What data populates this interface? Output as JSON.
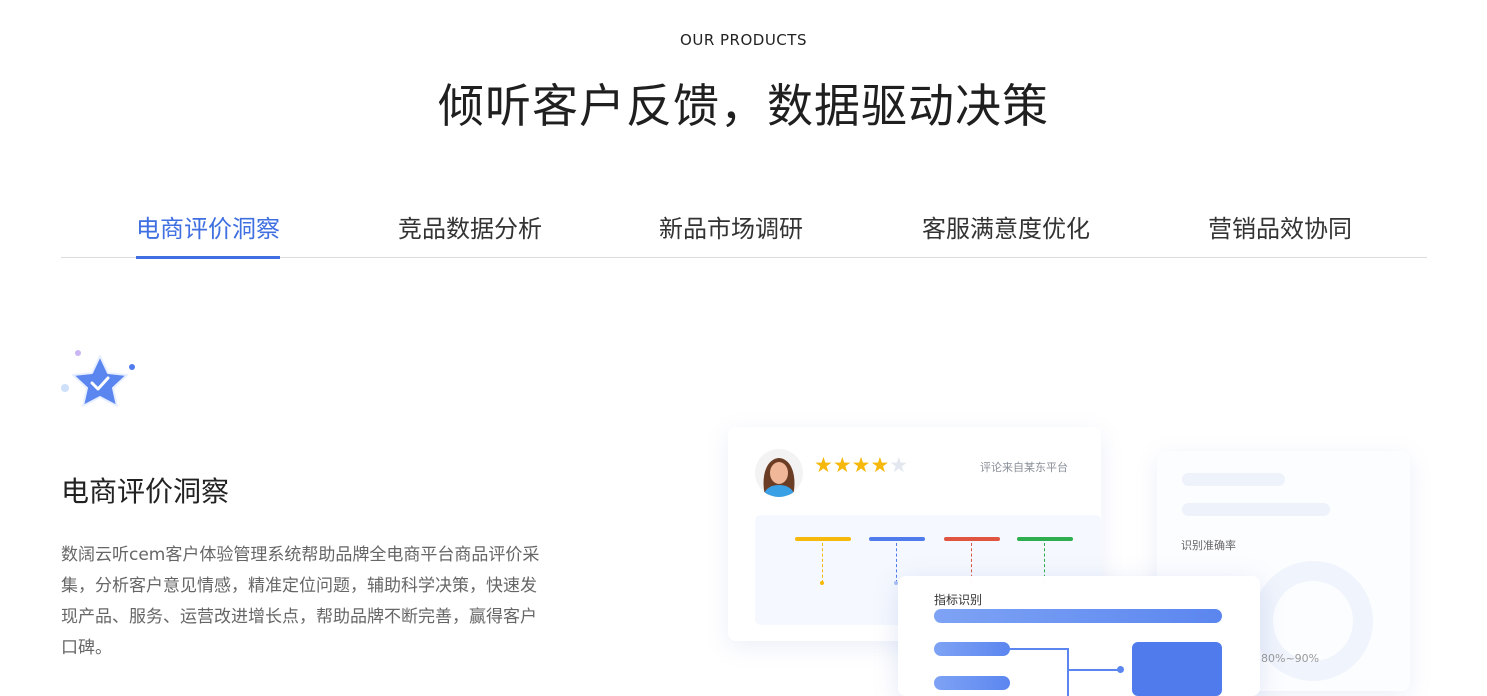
{
  "header": {
    "eyebrow": "OUR PRODUCTS",
    "headline": "倾听客户反馈，数据驱动决策"
  },
  "tabs": [
    {
      "label": "电商评价洞察",
      "active": true
    },
    {
      "label": "竞品数据分析",
      "active": false
    },
    {
      "label": "新品市场调研",
      "active": false
    },
    {
      "label": "客服满意度优化",
      "active": false
    },
    {
      "label": "营销品效协同",
      "active": false
    }
  ],
  "section": {
    "icon": "star-check-icon",
    "title": "电商评价洞察",
    "description": "数阔云听cem客户体验管理系统帮助品牌全电商平台商品评价采集，分析客户意见情感，精准定位问题，辅助科学决策，快速发现产品、服务、运营改进增长点，帮助品牌不断完善，赢得客户口碑。"
  },
  "illustration": {
    "review_card": {
      "rating": 4,
      "max_rating": 5,
      "source_text": "评论来自某东平台",
      "bar_colors": [
        "#f5b80b",
        "#4f7bec",
        "#e0553f",
        "#2eae4e"
      ]
    },
    "side_card": {
      "label": "识别准确率",
      "range": "80%~90%"
    },
    "bottom_card": {
      "label": "指标识别"
    },
    "accent_color": "#3f6fe0"
  }
}
